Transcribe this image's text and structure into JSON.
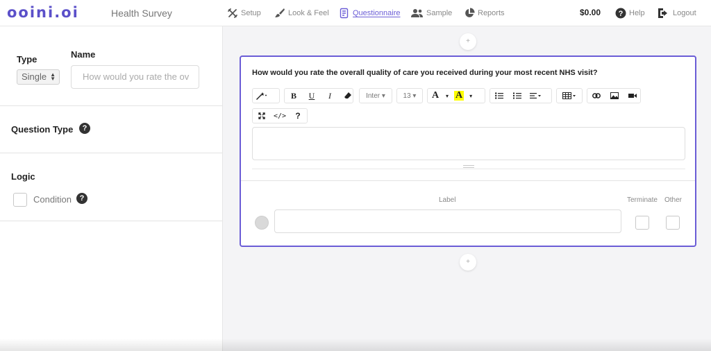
{
  "app": {
    "logo": "ooini.oi",
    "survey_title": "Health Survey",
    "accent": "#6a5cd6"
  },
  "nav": {
    "items": [
      {
        "label": "Setup",
        "icon": "tools-icon"
      },
      {
        "label": "Look & Feel",
        "icon": "brush-icon"
      },
      {
        "label": "Questionnaire",
        "icon": "questionnaire-icon",
        "active": true
      },
      {
        "label": "Sample",
        "icon": "users-icon"
      },
      {
        "label": "Reports",
        "icon": "pie-chart-icon"
      }
    ],
    "balance": "$0.00",
    "help": "Help",
    "logout": "Logout"
  },
  "sidebar": {
    "type_label": "Type",
    "type_value": "Single",
    "name_label": "Name",
    "name_value": "How would you rate the ov",
    "question_type_label": "Question Type",
    "logic_label": "Logic",
    "condition_label": "Condition"
  },
  "editor": {
    "question_text": "How would you rate the overall quality of care you received during your most recent NHS visit?",
    "toolbar": {
      "font": "Inter",
      "size": "13"
    },
    "answers_label_header": "Label",
    "terminate_header": "Terminate",
    "other_header": "Other",
    "add_symbol": "+"
  }
}
